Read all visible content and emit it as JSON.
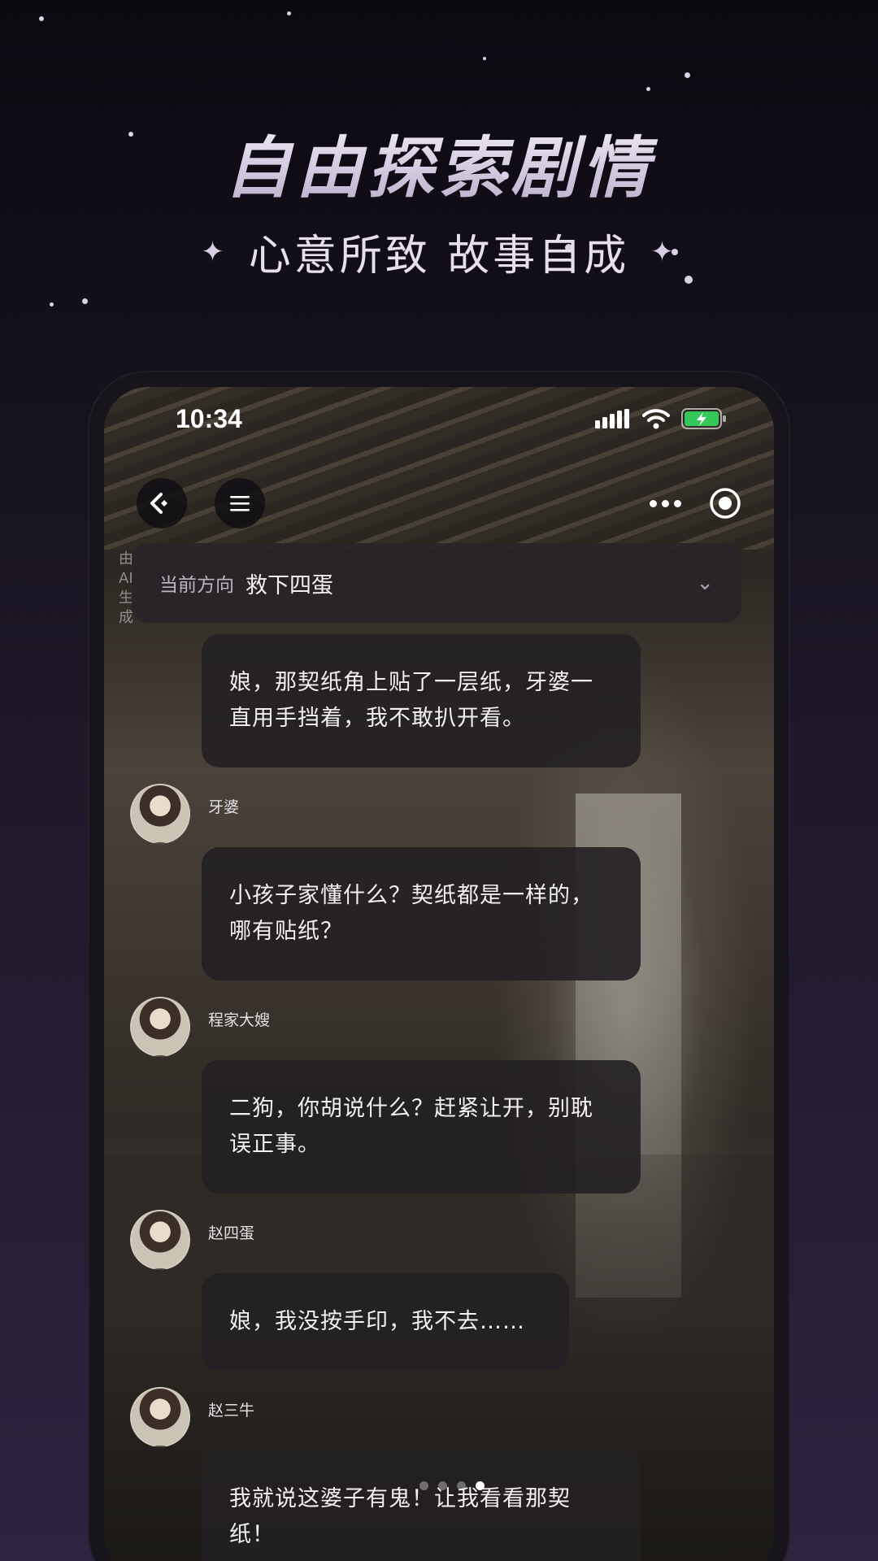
{
  "promo": {
    "headline": "自由探索剧情",
    "subline": "心意所致 故事自成"
  },
  "status_bar": {
    "time": "10:34",
    "battery_color": "#35c759"
  },
  "nav": {
    "back_icon": "back-arrow-icon",
    "menu_icon": "menu-icon",
    "more_icon": "more-dots-icon",
    "record_icon": "record-icon"
  },
  "side_note": "由AI生成",
  "direction": {
    "label": "当前方向",
    "value": "救下四蛋"
  },
  "messages": [
    {
      "speaker": "",
      "text": "娘，那契纸角上贴了一层纸，牙婆一直用手挡着，我不敢扒开看。"
    },
    {
      "speaker": "牙婆",
      "text": "小孩子家懂什么？契纸都是一样的，哪有贴纸？"
    },
    {
      "speaker": "程家大嫂",
      "text": "二狗，你胡说什么？赶紧让开，别耽误正事。"
    },
    {
      "speaker": "赵四蛋",
      "text": "娘，我没按手印，我不去……"
    },
    {
      "speaker": "赵三牛",
      "text": "我就说这婆子有鬼！让我看看那契纸！"
    }
  ],
  "pagination": {
    "current": 4,
    "total": 4
  }
}
